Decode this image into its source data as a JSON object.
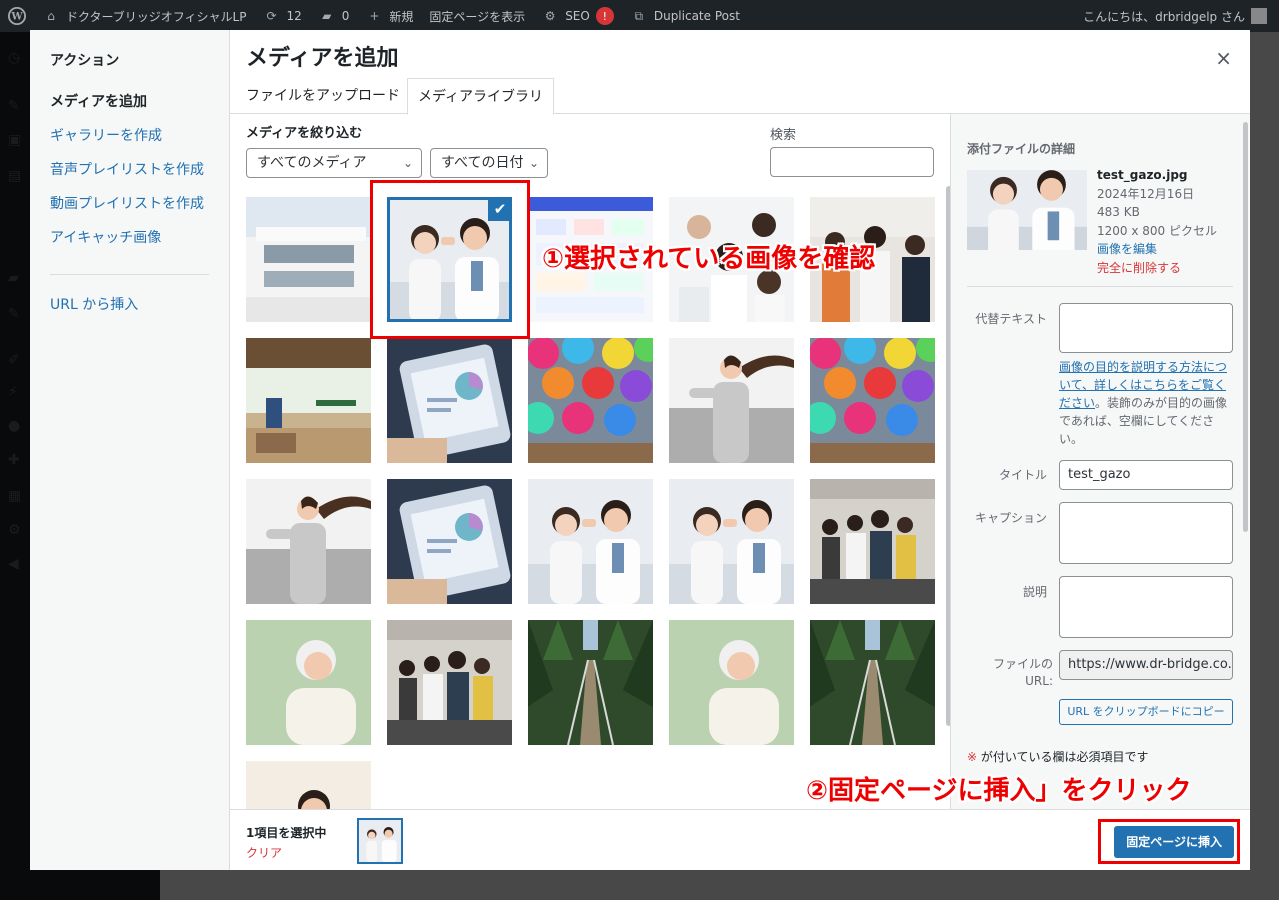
{
  "admin_bar": {
    "site_name": "ドクターブリッジオフィシャルLP",
    "updates_count": "12",
    "comments_count": "0",
    "new_label": "新規",
    "view_page_label": "固定ページを表示",
    "seo_label": "SEO",
    "seo_badge": "!",
    "duplicate_label": "Duplicate Post",
    "greeting": "こんにちは、drbridgelp さん"
  },
  "modal": {
    "menu_heading": "アクション",
    "menu_items": [
      {
        "label": "メディアを追加"
      },
      {
        "label": "ギャラリーを作成"
      },
      {
        "label": "音声プレイリストを作成"
      },
      {
        "label": "動画プレイリストを作成"
      },
      {
        "label": "アイキャッチ画像"
      }
    ],
    "insert_from_url": "URL から挿入",
    "title": "メディアを追加",
    "close_glyph": "×",
    "tabs": [
      "ファイルをアップロード",
      "メディアライブラリ"
    ],
    "filter_label": "メディアを絞り込む",
    "media_filter": "すべてのメディア",
    "date_filter": "すべての日付",
    "search_label": "検索"
  },
  "attachment": {
    "section_title": "添付ファイルの詳細",
    "filename": "test_gazo.jpg",
    "date": "2024年12月16日",
    "size": "483 KB",
    "dimensions": "1200 x 800 ピクセル",
    "edit_link": "画像を編集",
    "delete_link": "完全に削除する",
    "alt_label": "代替テキスト",
    "alt_help_link": "画像の目的を説明する方法について、詳しくはこちらをご覧ください",
    "alt_help_text": "。装飾のみが目的の画像であれば、空欄にしてください。",
    "title_label": "タイトル",
    "title_value": "test_gazo",
    "caption_label": "キャプション",
    "description_label": "説明",
    "file_url_label": "ファイルの URL:",
    "file_url_value": "https://www.dr-bridge.co.",
    "copy_button": "URL をクリップボードにコピー",
    "required_star": "※",
    "required_note": "が付いている欄は必須項目です"
  },
  "selection": {
    "count_text": "1項目を選択中",
    "clear_label": "クリア",
    "insert_button": "固定ページに挿入"
  },
  "annotations": {
    "step1": "①選択されている画像を確認",
    "step2": "②固定ページに挿入」をクリック",
    "color": "#ee0000"
  },
  "media_grid": [
    {
      "kind": "building"
    },
    {
      "kind": "doctor-girl",
      "selected": true
    },
    {
      "kind": "chart-map"
    },
    {
      "kind": "medical-staff"
    },
    {
      "kind": "business-team"
    },
    {
      "kind": "office-lounge"
    },
    {
      "kind": "tablet"
    },
    {
      "kind": "umbrellas"
    },
    {
      "kind": "woman-running"
    },
    {
      "kind": "umbrellas"
    },
    {
      "kind": "woman-running"
    },
    {
      "kind": "tablet"
    },
    {
      "kind": "doctor-girl"
    },
    {
      "kind": "doctor-girl"
    },
    {
      "kind": "group-office"
    },
    {
      "kind": "elderly-woman"
    },
    {
      "kind": "group-office"
    },
    {
      "kind": "bridge-forest"
    },
    {
      "kind": "elderly-woman"
    },
    {
      "kind": "bridge-forest"
    },
    {
      "kind": "man-smiling"
    }
  ],
  "check_glyph": "✔"
}
